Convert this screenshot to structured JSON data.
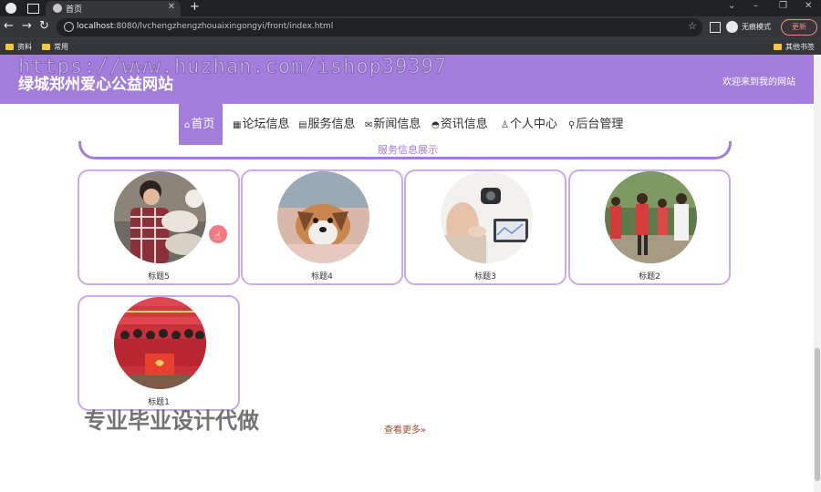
{
  "browser": {
    "tab_title": "首页",
    "url_host": "localhost",
    "url_rest": ":8080/lvchengzhengzhouaixingongyi/front/index.html",
    "incognito_label": "无痕模式",
    "update_label": "更新",
    "bookmarks": [
      "资料",
      "常用"
    ],
    "other_bookmarks": "其他书签"
  },
  "site": {
    "title": "绿城郑州爱心公益网站",
    "welcome": "欢迎来到我的网站"
  },
  "nav": [
    {
      "icon": "⌂",
      "label": "首页"
    },
    {
      "icon": "▦",
      "label": "论坛信息"
    },
    {
      "icon": "▤",
      "label": "服务信息"
    },
    {
      "icon": "✉",
      "label": "新闻信息"
    },
    {
      "icon": "◓",
      "label": "资讯信息"
    },
    {
      "icon": "♙",
      "label": "个人中心"
    },
    {
      "icon": "⚲",
      "label": "后台管理"
    }
  ],
  "section": {
    "title": "服务信息展示",
    "more": "查看更多»"
  },
  "cards": [
    {
      "caption": "标题5"
    },
    {
      "caption": "标题4"
    },
    {
      "caption": "标题3"
    },
    {
      "caption": "标题2"
    },
    {
      "caption": "标题1"
    }
  ],
  "watermarks": {
    "url": "https://www.huzhan.com/ishop39397",
    "text": "专业毕业设计代做"
  },
  "colors": {
    "accent": "#a27ddb",
    "card_border": "#c9a9ef"
  }
}
